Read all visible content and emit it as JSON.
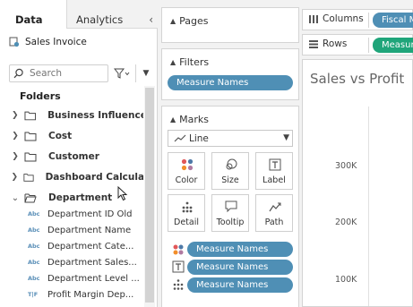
{
  "tabs": {
    "data": "Data",
    "analytics": "Analytics"
  },
  "datasource": {
    "name": "Sales Invoice"
  },
  "search": {
    "placeholder": "Search"
  },
  "folders_heading": "Folders",
  "folders": [
    {
      "label": "Business Influence",
      "expanded": false
    },
    {
      "label": "Cost",
      "expanded": false
    },
    {
      "label": "Customer",
      "expanded": false
    },
    {
      "label": "Dashboard Calculat...",
      "expanded": false
    },
    {
      "label": "Department",
      "expanded": true
    }
  ],
  "fields": [
    {
      "type": "Abc",
      "label": "Department ID Old"
    },
    {
      "type": "Abc",
      "label": "Department Name"
    },
    {
      "type": "Abc",
      "label": "Department Cate..."
    },
    {
      "type": "Abc",
      "label": "Department Sales..."
    },
    {
      "type": "Abc",
      "label": "Department Level ..."
    },
    {
      "type": "T|F",
      "label": "Profit Margin Dep..."
    }
  ],
  "pages": {
    "title": "Pages"
  },
  "filters": {
    "title": "Filters",
    "pill": "Measure Names"
  },
  "marks": {
    "title": "Marks",
    "type": "Line",
    "buttons": [
      "Color",
      "Size",
      "Label",
      "Detail",
      "Tooltip",
      "Path"
    ],
    "cards": [
      {
        "icon": "color-dots-icon",
        "pill": "Measure Names"
      },
      {
        "icon": "label-text-icon",
        "pill": "Measure Names"
      },
      {
        "icon": "detail-dots-icon",
        "pill": "Measure Names"
      }
    ]
  },
  "shelves": {
    "columns": {
      "label": "Columns",
      "pill": "Fiscal M",
      "color": "#4f8fb5"
    },
    "rows": {
      "label": "Rows",
      "pill": "Measur",
      "color": "#1fa57a"
    }
  },
  "view": {
    "title": "Sales vs Profit",
    "ticks": [
      "300K",
      "200K",
      "100K"
    ]
  },
  "colors": {
    "blue_pill": "#4f8fb5",
    "green_pill": "#1fa57a"
  }
}
